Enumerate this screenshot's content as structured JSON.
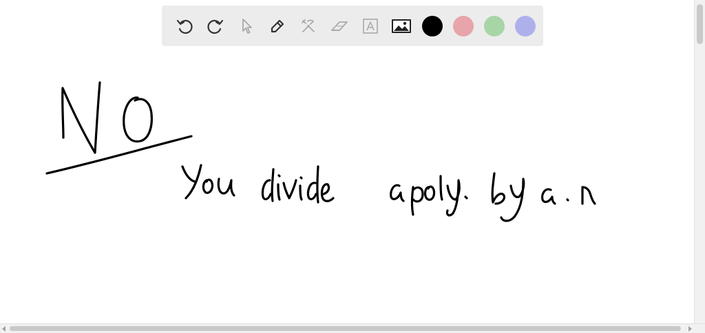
{
  "toolbar": {
    "tools": [
      {
        "name": "undo-icon",
        "active": true
      },
      {
        "name": "redo-icon",
        "active": true
      },
      {
        "name": "select-pointer-icon",
        "active": false
      },
      {
        "name": "pen-icon",
        "active": true
      },
      {
        "name": "tools-icon",
        "active": false
      },
      {
        "name": "eraser-icon",
        "active": false
      },
      {
        "name": "text-box-icon",
        "active": false
      },
      {
        "name": "image-icon",
        "active": true
      }
    ],
    "colors": [
      "#000000",
      "#e8a4ab",
      "#a8d5a6",
      "#aeb0ec"
    ],
    "selected_color": "#000000"
  },
  "canvas": {
    "ink_color": "#000000",
    "strokes_text": [
      {
        "id": "heading",
        "text": "NO"
      },
      {
        "id": "sentence",
        "text": "You divide a poly. by a. n"
      }
    ]
  }
}
